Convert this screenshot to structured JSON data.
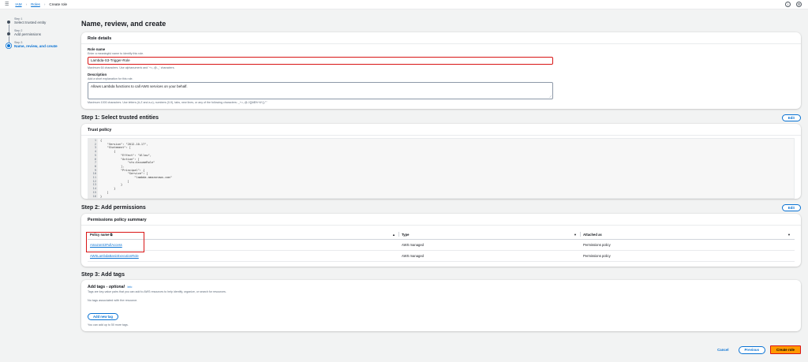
{
  "breadcrumb": {
    "iam": "IAM",
    "roles": "Roles",
    "current": "Create role"
  },
  "steps": [
    {
      "num": "Step 1",
      "label": "Select trusted entity"
    },
    {
      "num": "Step 2",
      "label": "Add permissions"
    },
    {
      "num": "Step 3",
      "label": "Name, review, and create"
    }
  ],
  "page_title": "Name, review, and create",
  "role_details": {
    "title": "Role details",
    "name_label": "Role name",
    "name_desc": "Enter a meaningful name to identify this role.",
    "name_value": "Lambda-S3-Trigger-Role",
    "name_hint": "Maximum 64 characters. Use alphanumeric and '+=,.@-_' characters.",
    "desc_label": "Description",
    "desc_desc": "Add a short explanation for this role.",
    "desc_value": "Allows Lambda functions to call AWS services on your behalf.",
    "desc_hint": "Maximum 1000 characters. Use letters (A-Z and a-z), numbers (0-9), tabs, new lines, or any of the following characters: _+=,.@-/\\[]!#$%^&*();'\"'"
  },
  "step1": {
    "title": "Step 1: Select trusted entities",
    "edit": "Edit",
    "policy_title": "Trust policy",
    "code_lines": [
      "{",
      "    \"Version\": \"2012-10-17\",",
      "    \"Statement\": [",
      "        {",
      "            \"Effect\": \"Allow\",",
      "            \"Action\": [",
      "                \"sts:AssumeRole\"",
      "            ],",
      "            \"Principal\": {",
      "                \"Service\": [",
      "                    \"lambda.amazonaws.com\"",
      "                ]",
      "            }",
      "        }",
      "    ]",
      "}"
    ]
  },
  "step2": {
    "title": "Step 2: Add permissions",
    "edit": "Edit",
    "summary_title": "Permissions policy summary",
    "columns": [
      "Policy name",
      "Type",
      "Attached as"
    ],
    "rows": [
      {
        "name": "AmazonS3FullAccess",
        "type": "AWS managed",
        "attached": "Permissions policy"
      },
      {
        "name": "AWSLambdaBasicExecutionRole",
        "type": "AWS managed",
        "attached": "Permissions policy"
      }
    ]
  },
  "step3": {
    "title": "Step 3: Add tags",
    "tags_title": "Add tags - ",
    "tags_optional": "optional",
    "tags_info": "Info",
    "tags_desc": "Tags are key-value pairs that you can add to AWS resources to help identify, organize, or search for resources.",
    "no_tags": "No tags associated with the resource.",
    "add_tag": "Add new tag",
    "tags_hint": "You can add up to 50 more tags."
  },
  "footer": {
    "cancel": "Cancel",
    "previous": "Previous",
    "create": "Create role"
  },
  "icons": {
    "menu": "hamburger-icon",
    "external": "external-link-icon",
    "info": "info-icon",
    "settings": "gear-icon"
  },
  "colors": {
    "link": "#0972d3",
    "primary_button": "#ff9900",
    "highlight": "#d91515"
  }
}
